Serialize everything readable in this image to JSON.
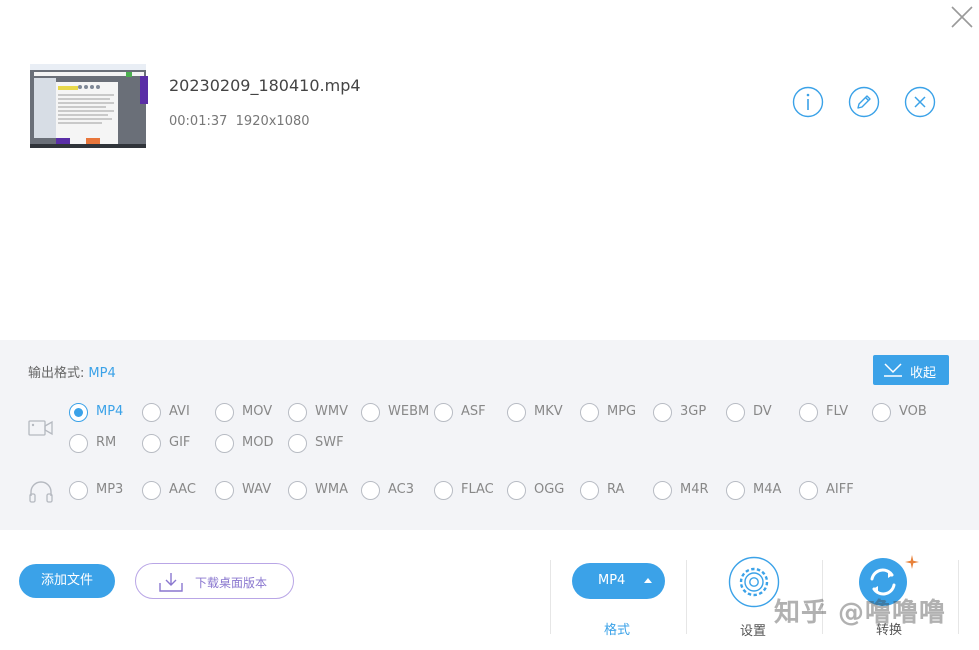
{
  "file": {
    "name": "20230209_180410.mp4",
    "duration": "00:01:37",
    "resolution": "1920x1080",
    "thumbnail_icon": "video-thumbnail"
  },
  "file_actions": [
    {
      "name": "info-icon"
    },
    {
      "name": "edit-pencil-icon"
    },
    {
      "name": "remove-file-icon"
    }
  ],
  "format_panel": {
    "output_label": "输出格式:",
    "output_value": "MP4",
    "collapse_label": "收起",
    "video_formats": [
      {
        "label": "MP4",
        "selected": true
      },
      {
        "label": "AVI"
      },
      {
        "label": "MOV"
      },
      {
        "label": "WMV"
      },
      {
        "label": "WEBM"
      },
      {
        "label": "ASF"
      },
      {
        "label": "MKV"
      },
      {
        "label": "MPG"
      },
      {
        "label": "3GP"
      },
      {
        "label": "DV"
      },
      {
        "label": "FLV"
      },
      {
        "label": "VOB"
      },
      {
        "label": "RM"
      },
      {
        "label": "GIF"
      },
      {
        "label": "MOD"
      },
      {
        "label": "SWF"
      }
    ],
    "audio_formats": [
      {
        "label": "MP3"
      },
      {
        "label": "AAC"
      },
      {
        "label": "WAV"
      },
      {
        "label": "WMA"
      },
      {
        "label": "AC3"
      },
      {
        "label": "FLAC"
      },
      {
        "label": "OGG"
      },
      {
        "label": "RA"
      },
      {
        "label": "M4R"
      },
      {
        "label": "M4A"
      },
      {
        "label": "AIFF"
      }
    ]
  },
  "toolbar": {
    "add_file_label": "添加文件",
    "download_desktop_label": "下载桌面版本",
    "format_button_label": "MP4",
    "format_caption": "格式",
    "settings_caption": "设置",
    "convert_caption": "转换"
  },
  "watermark": "知乎 @噜噜噜",
  "colors": {
    "accent": "#3ba2e8",
    "panel_bg": "#f3f4f7",
    "download_border": "#b9a6e6",
    "sparkle": "#e8823b"
  }
}
